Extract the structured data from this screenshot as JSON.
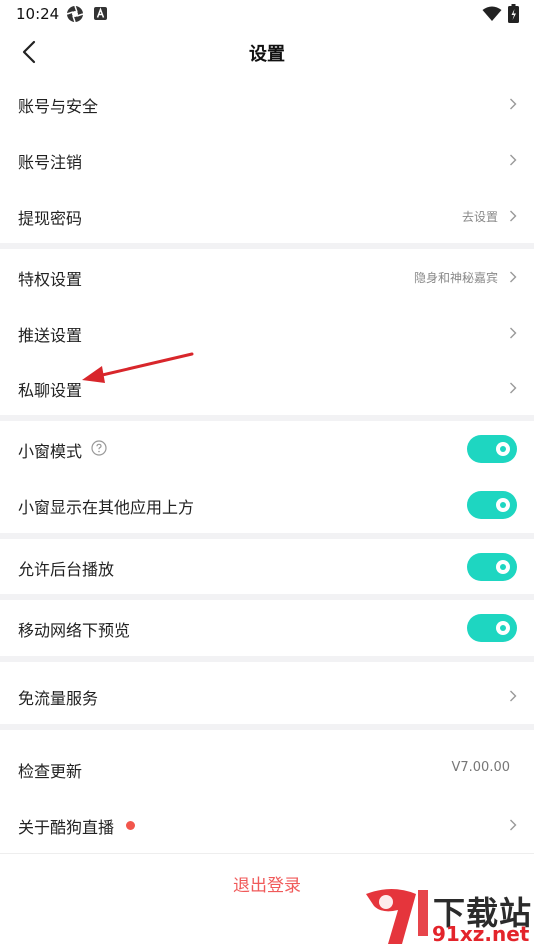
{
  "status_bar": {
    "time": "10:24",
    "icons": [
      "aperture-icon",
      "a-badge-icon",
      "wifi-icon",
      "battery-charging-icon"
    ]
  },
  "nav": {
    "title": "设置",
    "back_icon": "chevron-left-icon"
  },
  "sections": [
    {
      "items": [
        {
          "label": "账号与安全",
          "value": "",
          "control": "chevron"
        },
        {
          "label": "账号注销",
          "value": "",
          "control": "chevron"
        },
        {
          "label": "提现密码",
          "value": "去设置",
          "control": "chevron"
        }
      ]
    },
    {
      "items": [
        {
          "label": "特权设置",
          "value": "隐身和神秘嘉宾",
          "control": "chevron"
        },
        {
          "label": "推送设置",
          "value": "",
          "control": "chevron"
        },
        {
          "label": "私聊设置",
          "value": "",
          "control": "chevron"
        }
      ]
    },
    {
      "items": [
        {
          "label": "小窗模式",
          "control": "toggle",
          "on": true,
          "help_icon": "question-circle-icon"
        },
        {
          "label": "小窗显示在其他应用上方",
          "control": "toggle",
          "on": true
        }
      ]
    },
    {
      "items": [
        {
          "label": "允许后台播放",
          "control": "toggle",
          "on": true
        }
      ]
    },
    {
      "items": [
        {
          "label": "移动网络下预览",
          "control": "toggle",
          "on": true
        }
      ]
    },
    {
      "items": [
        {
          "label": "免流量服务",
          "value": "",
          "control": "chevron"
        }
      ]
    },
    {
      "items": [
        {
          "label": "检查更新",
          "value": "V7.00.00",
          "control": "none"
        },
        {
          "label": "关于酷狗直播",
          "value": "",
          "control": "chevron",
          "badge": "red-dot"
        }
      ]
    }
  ],
  "logout_label": "退出登录",
  "colors": {
    "toggle_on": "#1ed6c1",
    "logout_text": "#f05a5a",
    "divider": "#f2f2f4",
    "annotation_arrow": "#d8262b"
  },
  "watermark": {
    "text": "下载站",
    "url": "91xz.net"
  }
}
